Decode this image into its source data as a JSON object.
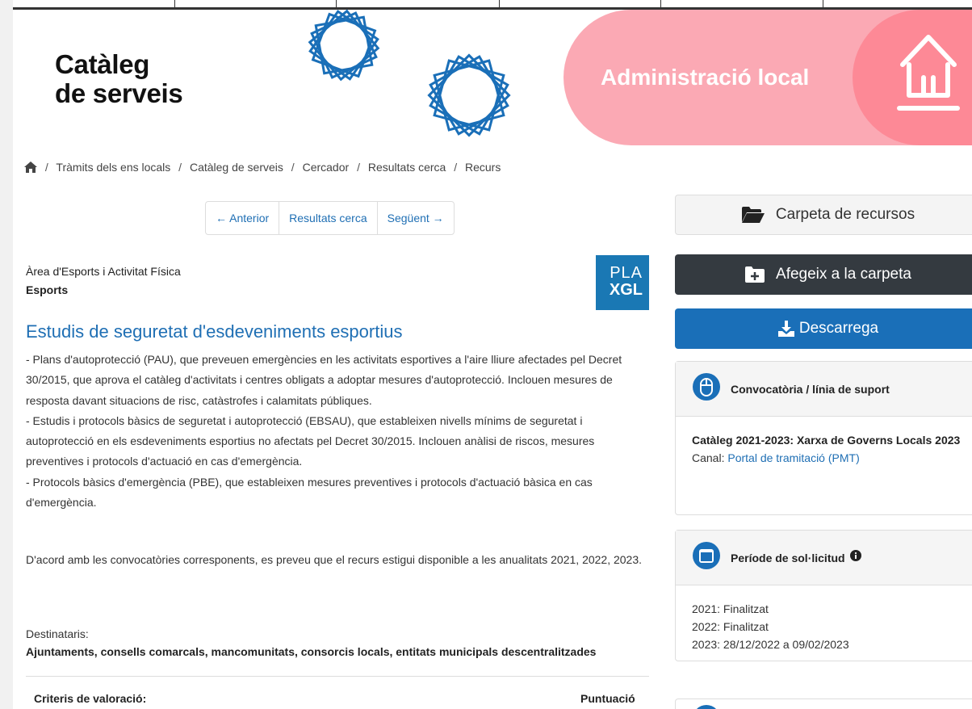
{
  "banner": {
    "brand_line1": "Catàleg",
    "brand_line2": "de serveis",
    "admin_label": "Administració local"
  },
  "breadcrumb": [
    "Tràmits dels ens locals",
    "Catàleg de serveis",
    "Cercador",
    "Resultats cerca",
    "Recurs"
  ],
  "pager": {
    "previous": "← Anterior",
    "results": "Resultats cerca",
    "next": "Següent →"
  },
  "resource": {
    "area": "Àrea d'Esports i Activitat Física",
    "subarea": "Esports",
    "logo_line1": "PLA",
    "logo_line2": "XGL",
    "title": "Estudis de seguretat d'esdeveniments esportius",
    "description": [
      "- Plans d'autoprotecció (PAU), que preveuen emergències en les activitats esportives a l'aire lliure afectades pel Decret 30/2015, que aprova el catàleg d'activitats i centres obligats a adoptar mesures d'autoprotecció. Inclouen mesures de resposta davant situacions de risc, catàstrofes i calamitats públiques.",
      "- Estudis i protocols bàsics de seguretat i autoprotecció (EBSAU), que estableixen nivells mínims de seguretat i autoprotecció en els esdeveniments esportius no afectats pel Decret 30/2015. Inclouen anàlisi de riscos, mesures preventives i protocols d'actuació en cas d'emergència.",
      "- Protocols bàsics d'emergència (PBE), que estableixen mesures preventives i protocols d'actuació bàsica en cas d'emergència."
    ],
    "availability": "D'acord amb les convocatòries corresponents, es preveu que el recurs estigui disponible a les anualitats 2021, 2022, 2023.",
    "recipients_label": "Destinataris:",
    "recipients": "Ajuntaments, consells comarcals, mancomunitats, consorcis locals, entitats municipals descentralitzades",
    "criteria_label": "Criteris de valoració:",
    "score_label": "Puntuació"
  },
  "sidebar": {
    "folder_button": "Carpeta de recursos",
    "add_button": "Afegeix a la carpeta",
    "download_button": "Descarrega",
    "call_card": {
      "title": "Convocatòria / línia de suport",
      "name": "Catàleg 2021-2023: Xarxa de Governs Locals 2023",
      "channel_label": "Canal: ",
      "channel_link": "Portal de tramitació (PMT)"
    },
    "period_card": {
      "title": "Període de sol·licitud",
      "lines": [
        "2021: Finalitzat",
        "2022: Finalitzat",
        "2023: 28/12/2022 a 09/02/2023"
      ]
    }
  },
  "colors": {
    "link_blue": "#1f6fb4",
    "dark_button": "#343a40",
    "download_blue": "#1a6fb8",
    "pink_light": "#fba9b4",
    "pink_dark": "#fd8996"
  }
}
